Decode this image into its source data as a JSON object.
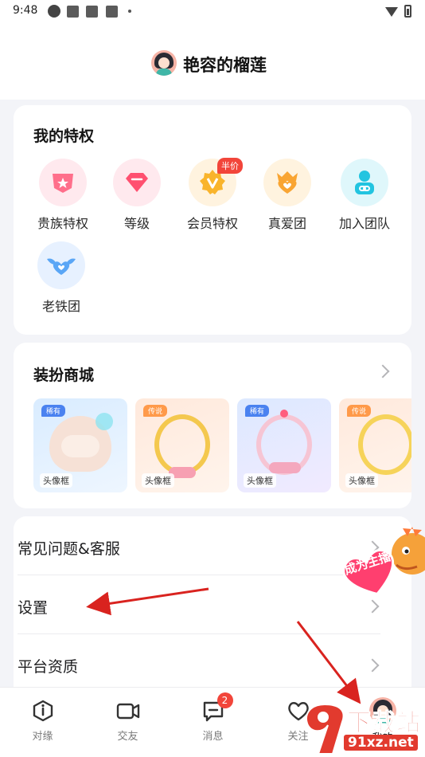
{
  "status_bar": {
    "time": "9:48"
  },
  "header": {
    "username": "艳容的榴莲"
  },
  "privileges": {
    "title": "我的特权",
    "items": [
      {
        "label": "贵族特权",
        "icon": "noble-crown-icon"
      },
      {
        "label": "等级",
        "icon": "diamond-icon"
      },
      {
        "label": "会员特权",
        "icon": "vip-badge-icon",
        "badge": "半价"
      },
      {
        "label": "真爱团",
        "icon": "heart-crown-icon"
      },
      {
        "label": "加入团队",
        "icon": "team-link-icon"
      },
      {
        "label": "老铁团",
        "icon": "heart-wings-icon"
      }
    ]
  },
  "shop": {
    "title": "装扮商城",
    "items": [
      {
        "tag": "稀有",
        "label": "头像框"
      },
      {
        "tag": "传说",
        "label": "头像框"
      },
      {
        "tag": "稀有",
        "label": "头像框"
      },
      {
        "tag": "传说",
        "label": "头像框"
      }
    ]
  },
  "menu": {
    "items": [
      {
        "label": "常见问题&客服"
      },
      {
        "label": "设置"
      },
      {
        "label": "平台资质"
      }
    ]
  },
  "promo": {
    "text": "成为主播"
  },
  "tabbar": {
    "items": [
      {
        "label": "对缘",
        "icon": "info-circle-icon"
      },
      {
        "label": "交友",
        "icon": "video-camera-icon"
      },
      {
        "label": "消息",
        "icon": "message-icon",
        "badge": "2"
      },
      {
        "label": "关注",
        "icon": "heart-outline-icon"
      },
      {
        "label": "我的",
        "icon": "avatar-icon"
      }
    ]
  },
  "watermark": {
    "title": "下载站",
    "url": "91xz.net"
  },
  "colors": {
    "accent": "#f2453a",
    "arrow": "#d9231f",
    "background": "#f3f4f8"
  }
}
